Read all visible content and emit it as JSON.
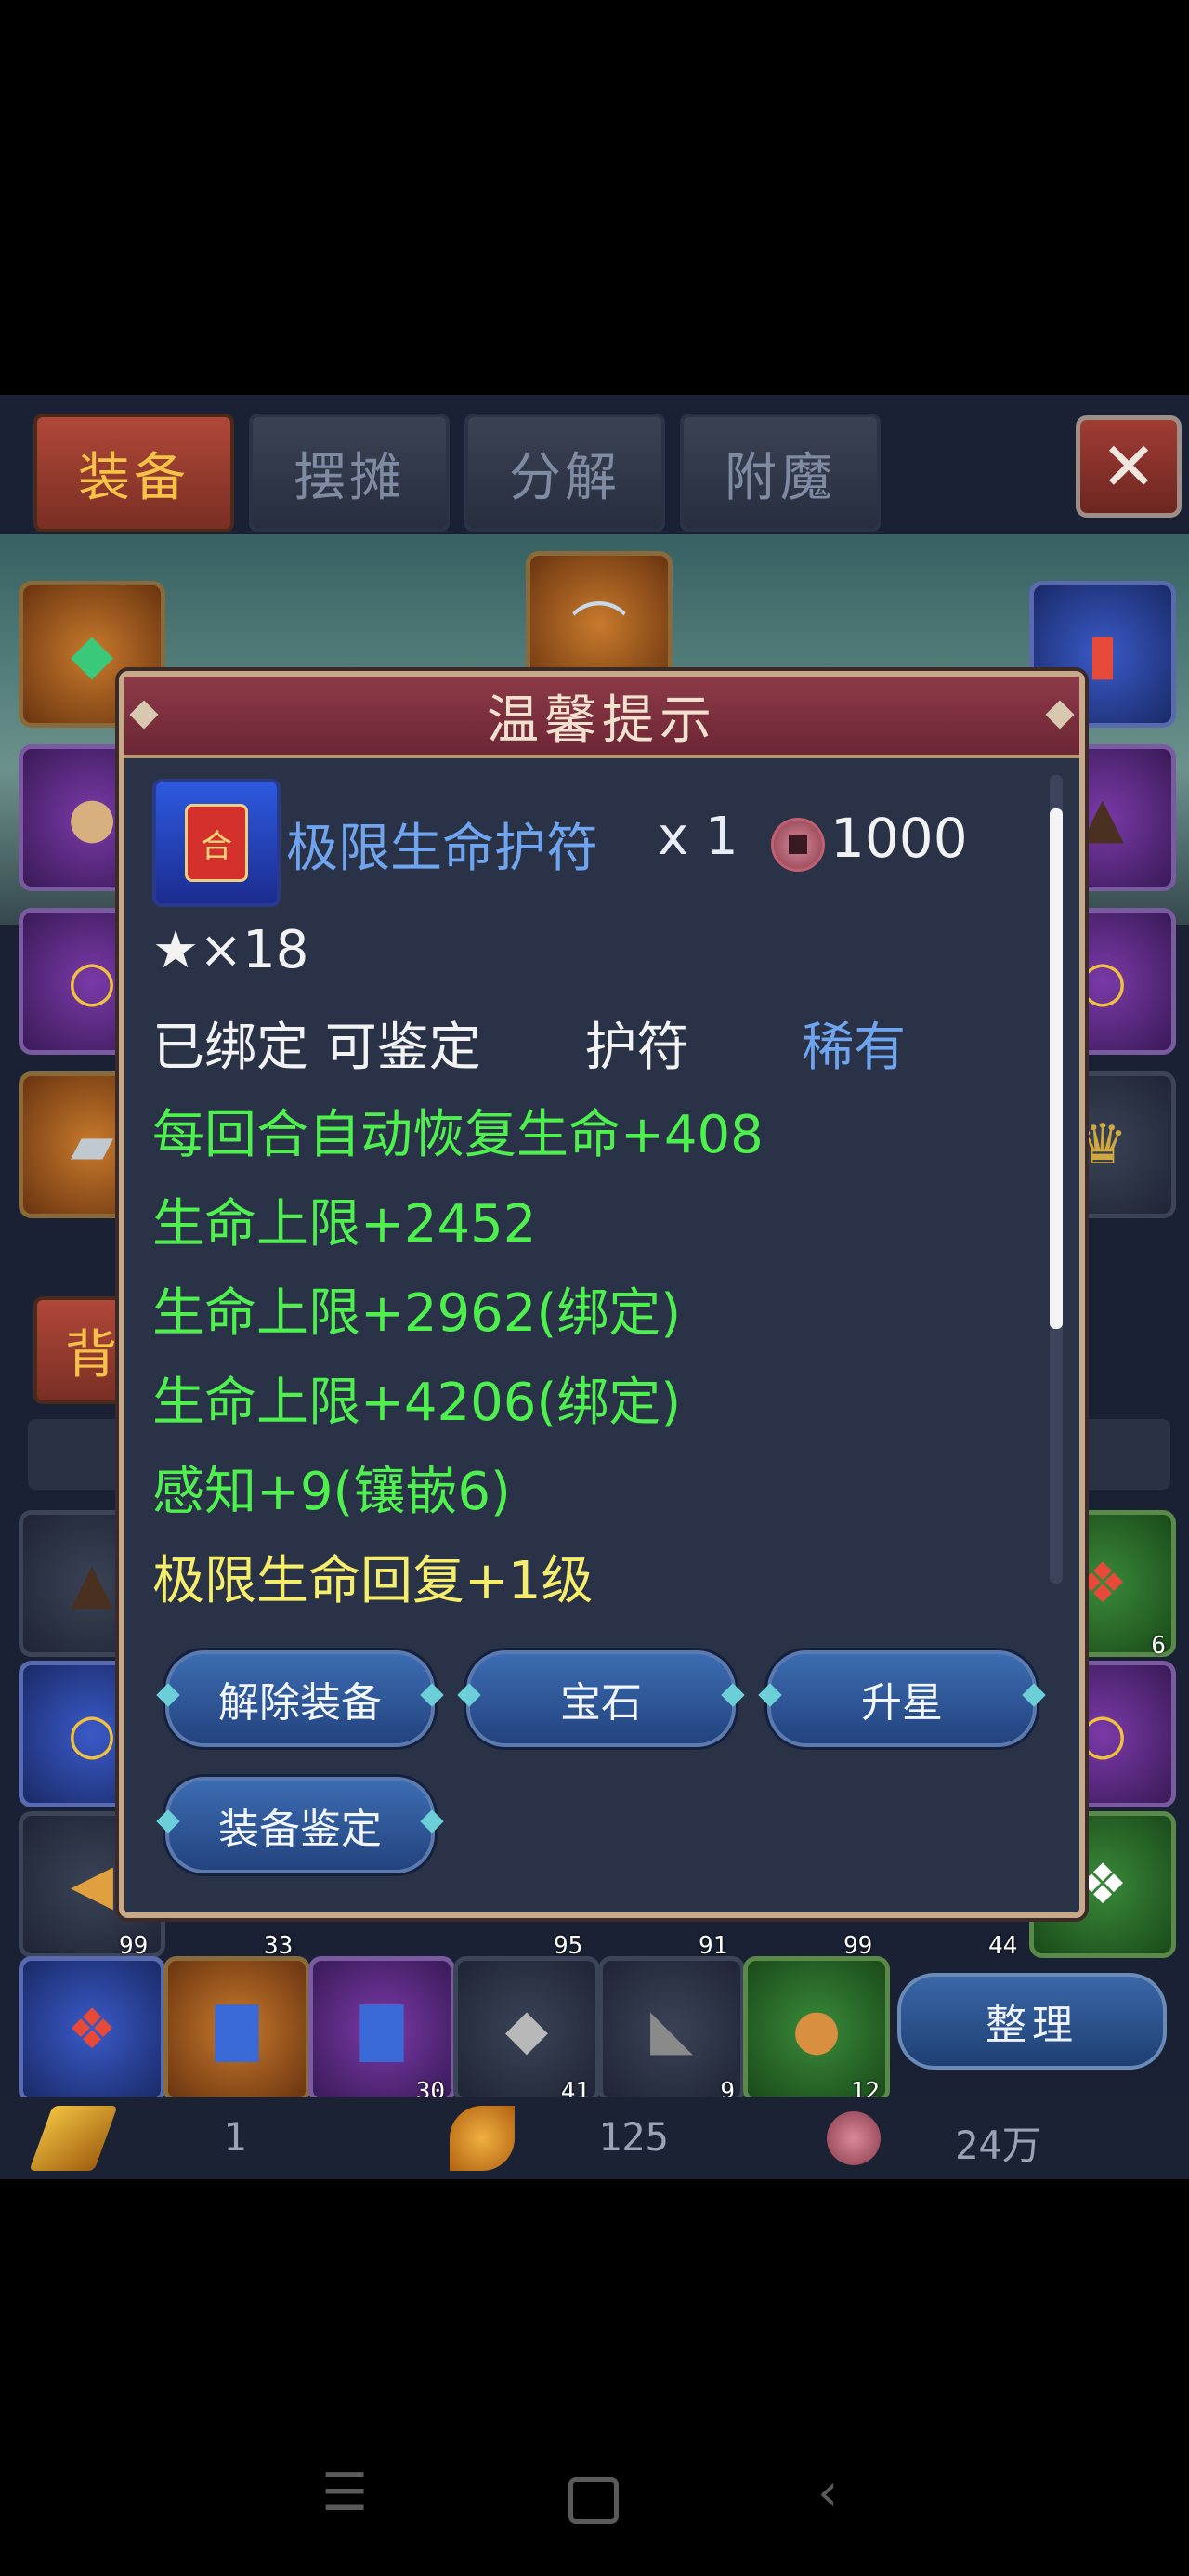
{
  "tabs": [
    {
      "label": "装备",
      "active": true
    },
    {
      "label": "摆摊",
      "active": false
    },
    {
      "label": "分解",
      "active": false
    },
    {
      "label": "附魔",
      "active": false
    }
  ],
  "close_label": "✕",
  "partial_labels": {
    "bag_tab": "背"
  },
  "inventory_counts": {
    "r3": [
      "99",
      "33",
      "95",
      "91",
      "99",
      "44"
    ],
    "r4": [
      "30",
      "41",
      "9",
      "12"
    ],
    "side": "6"
  },
  "sort_button": "整理",
  "currency": {
    "gold": "1",
    "leaf": "125",
    "coin": "24万"
  },
  "dialog": {
    "title": "温馨提示",
    "item": {
      "name": "极限生命护符",
      "quantity": "x 1",
      "price": "1000",
      "tag_char": "合",
      "stars": "★×18"
    },
    "info_line": {
      "status": "已绑定 可鉴定",
      "type": "护符",
      "rarity": "稀有"
    },
    "attributes": [
      "每回合自动恢复生命+408",
      "生命上限+2452",
      "生命上限+2962(绑定)",
      "生命上限+4206(绑定)",
      "感知+9(镶嵌6)"
    ],
    "special": "极限生命回复+1级",
    "buttons": {
      "unequip": "解除装备",
      "gem": "宝石",
      "upgrade_star": "升星",
      "identify": "装备鉴定"
    }
  },
  "colors": {
    "attr_green": "#4ef04e",
    "special_yellow": "#f6ee6a",
    "rarity_blue": "#6fa4ee",
    "dialog_header": "#8d3a48"
  }
}
